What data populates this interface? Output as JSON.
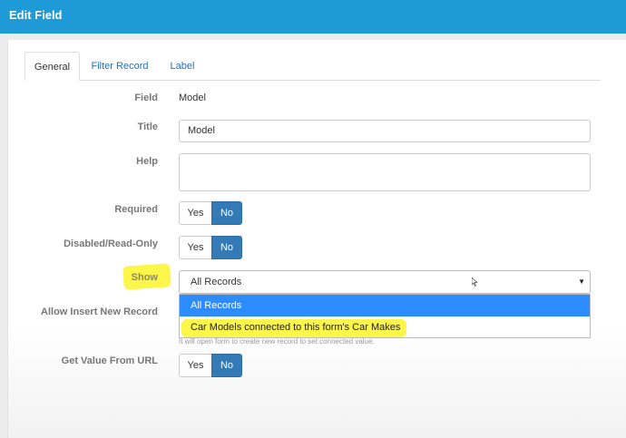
{
  "header": {
    "title": "Edit Field"
  },
  "tabs": [
    {
      "label": "General",
      "active": true
    },
    {
      "label": "Filter Record",
      "active": false
    },
    {
      "label": "Label",
      "active": false
    }
  ],
  "form": {
    "field": {
      "label": "Field",
      "value": "Model"
    },
    "title": {
      "label": "Title",
      "value": "Model"
    },
    "help": {
      "label": "Help",
      "value": ""
    },
    "required": {
      "label": "Required",
      "yes": "Yes",
      "no": "No",
      "selected": "No"
    },
    "disabled": {
      "label": "Disabled/Read-Only",
      "yes": "Yes",
      "no": "No",
      "selected": "No"
    },
    "show": {
      "label": "Show",
      "value": "All Records",
      "options": [
        "All Records",
        "Car Models connected to this form's Car Makes"
      ]
    },
    "allow_insert": {
      "label": "Allow Insert New Record",
      "hint": "It will open form to create new record to set connected value."
    },
    "get_value": {
      "label": "Get Value From URL",
      "yes": "Yes",
      "no": "No",
      "selected": "No"
    }
  },
  "colors": {
    "header": "#1e9bd7",
    "toggle_active": "#337ab7",
    "dropdown_selected": "#2d8cff",
    "highlight": "#fcf54a",
    "link": "#2a6fb5"
  }
}
